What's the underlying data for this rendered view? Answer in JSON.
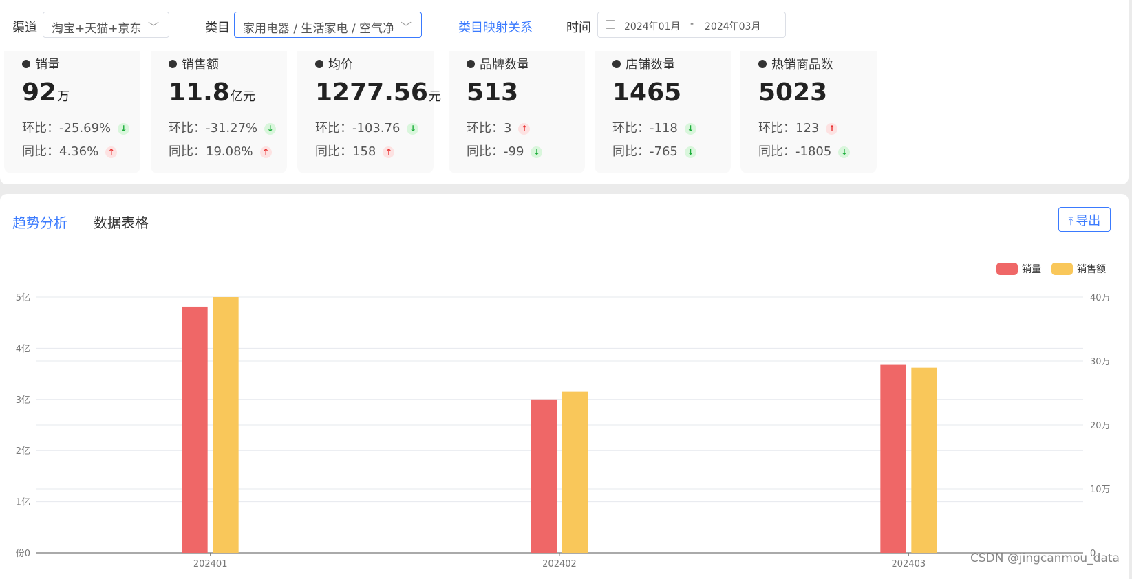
{
  "filters": {
    "channel_label": "渠道",
    "channel_value": "淘宝+天猫+京东",
    "category_label": "类目",
    "category_value": "家用电器 / 生活家电 / 空气净",
    "mapping_link": "类目映射关系",
    "time_label": "时间",
    "date_start": "2024年01月",
    "date_sep": "-",
    "date_end": "2024年03月"
  },
  "kpis": [
    {
      "title": "销量",
      "value": "92",
      "unit": "万",
      "mom_label": "环比：",
      "mom": "-25.69%",
      "mom_dir": "down",
      "yoy_label": "同比：",
      "yoy": "4.36%",
      "yoy_dir": "up"
    },
    {
      "title": "销售额",
      "value": "11.8",
      "unit": "亿元",
      "mom_label": "环比：",
      "mom": "-31.27%",
      "mom_dir": "down",
      "yoy_label": "同比：",
      "yoy": "19.08%",
      "yoy_dir": "up"
    },
    {
      "title": "均价",
      "value": "1277.56",
      "unit": "元",
      "mom_label": "环比：",
      "mom": "-103.76",
      "mom_dir": "down",
      "yoy_label": "同比：",
      "yoy": "158",
      "yoy_dir": "up"
    },
    {
      "title": "品牌数量",
      "value": "513",
      "unit": "",
      "mom_label": "环比：",
      "mom": "3",
      "mom_dir": "up",
      "yoy_label": "同比：",
      "yoy": "-99",
      "yoy_dir": "down"
    },
    {
      "title": "店铺数量",
      "value": "1465",
      "unit": "",
      "mom_label": "环比：",
      "mom": "-118",
      "mom_dir": "down",
      "yoy_label": "同比：",
      "yoy": "-765",
      "yoy_dir": "down"
    },
    {
      "title": "热销商品数",
      "value": "5023",
      "unit": "",
      "mom_label": "环比：",
      "mom": "123",
      "mom_dir": "up",
      "yoy_label": "同比：",
      "yoy": "-1805",
      "yoy_dir": "down"
    }
  ],
  "tabs": [
    {
      "label": "趋势分析",
      "active": true
    },
    {
      "label": "数据表格",
      "active": false
    }
  ],
  "export_label": "导出",
  "watermark": "CSDN @jingcanmou_data",
  "colors": {
    "accent": "#3a7afe",
    "sales_volume": "#ef6767",
    "sales_amount": "#f9c75a",
    "up": "#e83333",
    "down": "#1eae3c"
  },
  "chart_data": {
    "type": "bar",
    "categories": [
      "202401",
      "202402",
      "202403"
    ],
    "series": [
      {
        "name": "销量",
        "axis": "right",
        "values": [
          385000,
          240000,
          294000
        ]
      },
      {
        "name": "销售额",
        "axis": "left",
        "values": [
          500000000,
          315000000,
          362000000
        ]
      }
    ],
    "left_axis": {
      "ticks": [
        "0",
        "1亿",
        "2亿",
        "3亿",
        "4亿",
        "5亿"
      ],
      "ylim": [
        0,
        500000000
      ],
      "axis_name": "份"
    },
    "right_axis": {
      "ticks": [
        "0",
        "10万",
        "20万",
        "30万",
        "40万"
      ],
      "ylim": [
        0,
        400000
      ]
    },
    "legend_position": "top-right",
    "grid": true
  }
}
